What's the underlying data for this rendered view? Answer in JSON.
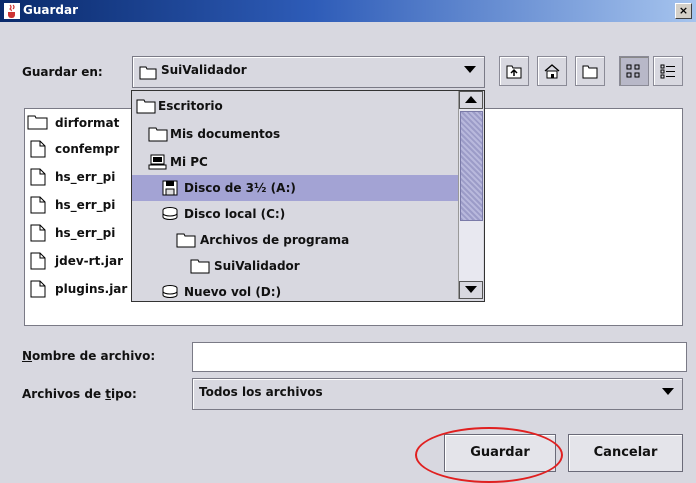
{
  "window": {
    "title": "Guardar",
    "close_glyph": "×"
  },
  "look_in": {
    "label": "Guardar en:",
    "value": "SuiValidador"
  },
  "toolbar": {
    "icons": [
      "up-folder-icon",
      "home-icon",
      "new-folder-icon",
      "list-view-icon",
      "details-view-icon"
    ]
  },
  "dropdown": {
    "items": [
      {
        "label": "Escritorio",
        "icon": "folder-icon"
      },
      {
        "label": "Mis documentos",
        "icon": "folder-icon"
      },
      {
        "label": "Mi PC",
        "icon": "computer-icon"
      },
      {
        "label": "Disco de 3½ (A:)",
        "icon": "floppy-icon",
        "selected": true
      },
      {
        "label": "Disco local (C:)",
        "icon": "hard-drive-icon"
      },
      {
        "label": "Archivos de programa",
        "icon": "folder-icon"
      },
      {
        "label": "SuiValidador",
        "icon": "folder-icon"
      },
      {
        "label": "Nuevo vol (D:)",
        "icon": "hard-drive-icon"
      }
    ]
  },
  "files": [
    {
      "name": "dirformat",
      "icon": "folder-icon"
    },
    {
      "name": "confempr",
      "icon": "file-icon"
    },
    {
      "name": "hs_err_pi",
      "icon": "file-icon"
    },
    {
      "name": "hs_err_pi",
      "icon": "file-icon"
    },
    {
      "name": "hs_err_pi",
      "icon": "file-icon"
    },
    {
      "name": "jdev-rt.jar",
      "icon": "file-icon"
    },
    {
      "name": "plugins.jar",
      "icon": "file-icon"
    }
  ],
  "filename": {
    "label_u": "N",
    "label_rest": "ombre de archivo:",
    "value": ""
  },
  "filetype": {
    "label_pre": "Archivos de ",
    "label_u": "t",
    "label_post": "ipo:",
    "value": "Todos los archivos"
  },
  "buttons": {
    "save": "Guardar",
    "cancel": "Cancelar"
  },
  "colors": {
    "selection": "#a3a3d4",
    "annotation": "#e02020"
  }
}
